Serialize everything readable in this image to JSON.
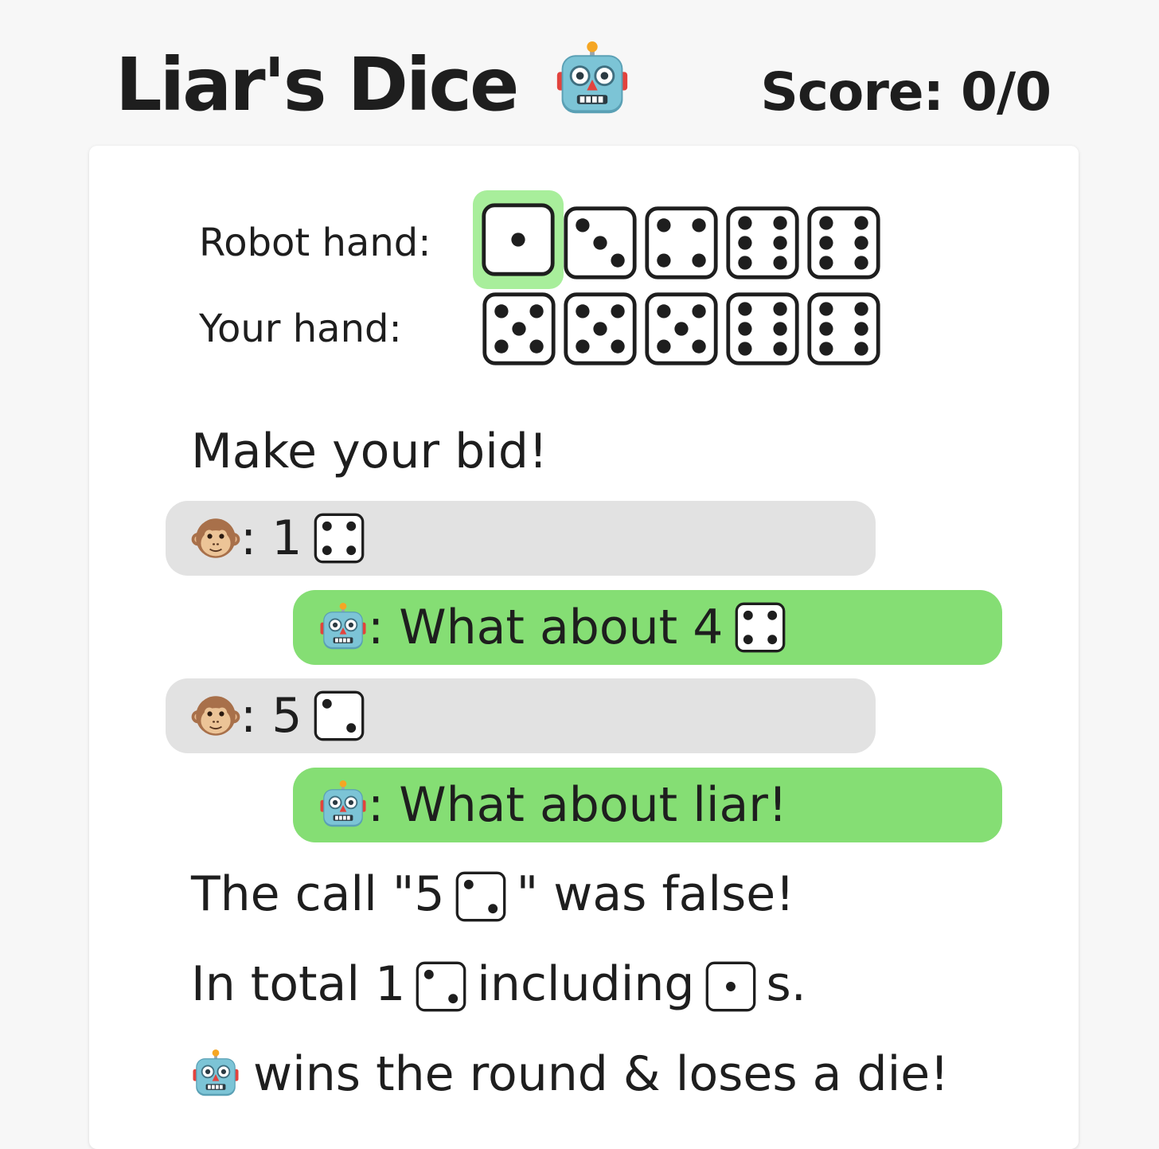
{
  "header": {
    "title": "Liar's Dice",
    "title_icon": "robot-icon",
    "score_label": "Score: 0/0"
  },
  "hands": {
    "robot_label": "Robot hand:",
    "robot_dice": [
      1,
      3,
      4,
      6,
      6
    ],
    "robot_held_index": 0,
    "your_label": "Your hand:",
    "your_dice": [
      5,
      5,
      5,
      6,
      6
    ]
  },
  "status": {
    "prompt": "Make your bid!"
  },
  "bids": [
    {
      "speaker": "human",
      "speaker_icon": "monkey-icon",
      "text": ": 1",
      "die": 4
    },
    {
      "speaker": "robot",
      "speaker_icon": "robot-icon",
      "text": ": What about 4",
      "die": 4
    },
    {
      "speaker": "human",
      "speaker_icon": "monkey-icon",
      "text": ": 5",
      "die": 2
    },
    {
      "speaker": "robot",
      "speaker_icon": "robot-icon",
      "text": ": What about liar!",
      "die": null
    }
  ],
  "result": {
    "line1_prefix": "The call \"5",
    "line1_die": 2,
    "line1_suffix": "\" was false!",
    "line2_prefix": "In total 1",
    "line2_die": 2,
    "line2_mid": "including",
    "line2_die2": 1,
    "line2_suffix": "s.",
    "line3_icon": "robot-icon",
    "line3_text": "wins the round & loses a die!"
  },
  "colors": {
    "robot_bubble": "#85de74",
    "human_bubble": "#e2e2e2",
    "held_die": "#a8ee9b"
  }
}
